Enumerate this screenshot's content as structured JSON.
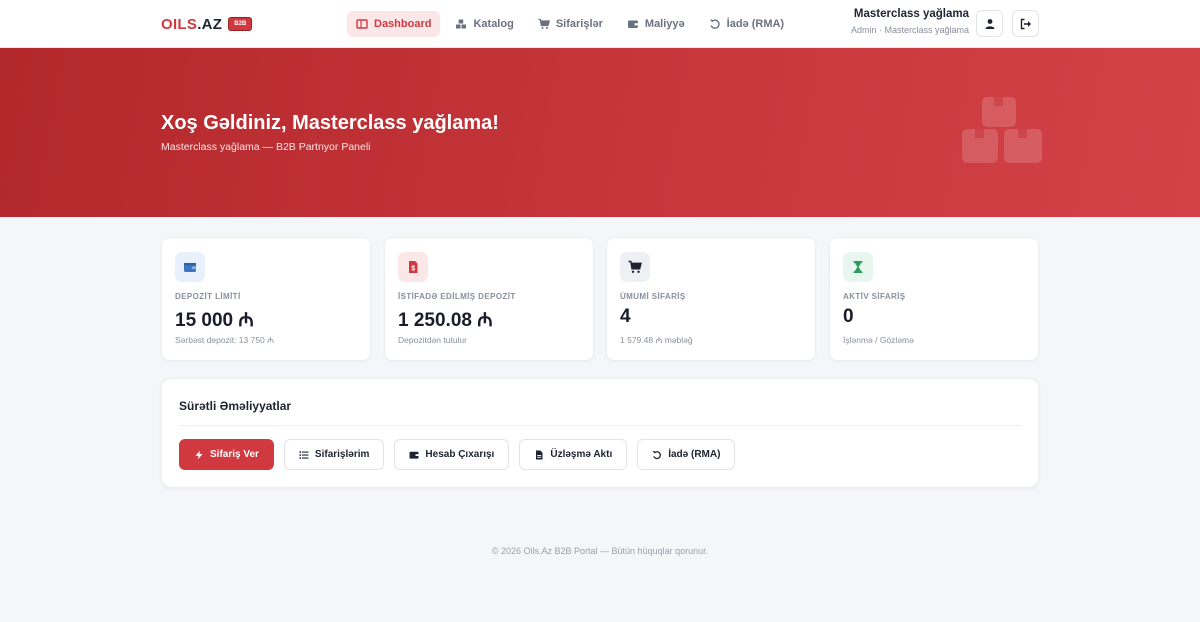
{
  "brand": {
    "name_a": "OILS",
    "name_b": ".AZ",
    "badge": "B2B",
    "color": "#d0393f"
  },
  "nav": [
    {
      "label": "Dashboard",
      "icon": "dashboard-icon",
      "active": true
    },
    {
      "label": "Katalog",
      "icon": "boxes-icon",
      "active": false
    },
    {
      "label": "Sifarişlər",
      "icon": "cart-icon",
      "active": false
    },
    {
      "label": "Maliyyə",
      "icon": "wallet-icon",
      "active": false
    },
    {
      "label": "İadə (RMA)",
      "icon": "undo-icon",
      "active": false
    }
  ],
  "user": {
    "name": "Masterclass yağlama",
    "role": "Admin · Masterclass yağlama"
  },
  "hero": {
    "title": "Xoş Gəldiniz, Masterclass yağlama!",
    "subtitle": "Masterclass yağlama — B2B Partnyor Paneli"
  },
  "stats": [
    {
      "label": "DEPOZİT LİMİTİ",
      "value": "15 000 ₼",
      "note": "Sərbəst depozit: 13 750 ₼",
      "icon": "wallet-icon",
      "icon_color": "#3b78c4",
      "icon_bg": "#e8f0fb"
    },
    {
      "label": "İSTİFADƏ EDİLMİŞ DEPOZİT",
      "value": "1 250.08 ₼",
      "note": "Depozitdən tutulur",
      "icon": "invoice-dollar-icon",
      "icon_color": "#d0393f",
      "icon_bg": "#fbe7e8"
    },
    {
      "label": "ÜMUMİ SİFARİŞ",
      "value": "4",
      "note": "1 579.48 ₼ məbləğ",
      "icon": "cart-icon",
      "icon_color": "#1f2230",
      "icon_bg": "#eef0f3"
    },
    {
      "label": "AKTİV SİFARİŞ",
      "value": "0",
      "note": "İşlənmə / Gözləmə",
      "icon": "hourglass-icon",
      "icon_color": "#2a9d5c",
      "icon_bg": "#e7f6ee"
    }
  ],
  "quick": {
    "title": "Sürətli Əməliyyatlar",
    "actions": [
      {
        "label": "Sifariş Ver",
        "icon": "bolt-icon",
        "primary": true
      },
      {
        "label": "Sifarişlərim",
        "icon": "list-icon",
        "primary": false
      },
      {
        "label": "Hesab Çıxarışı",
        "icon": "wallet-icon",
        "primary": false
      },
      {
        "label": "Üzləşmə Aktı",
        "icon": "file-icon",
        "primary": false
      },
      {
        "label": "İadə (RMA)",
        "icon": "undo-icon",
        "primary": false
      }
    ]
  },
  "footer": "© 2026 Oils.Az B2B Portal — Bütün hüquqlar qorunur."
}
